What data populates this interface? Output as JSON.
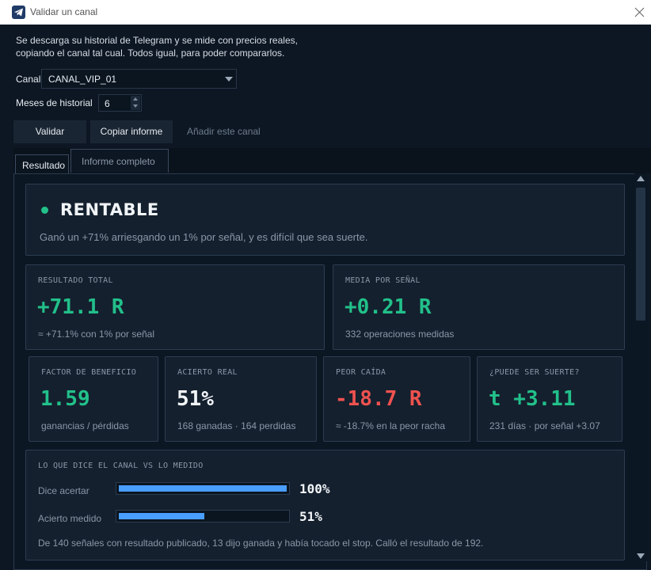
{
  "window": {
    "title": "Validar un canal"
  },
  "intro": {
    "line1": "Se descarga su historial de Telegram y se mide con precios reales,",
    "line2": "copiando el canal tal cual. Todos igual, para poder compararlos."
  },
  "form": {
    "channel_label": "Canal",
    "channel_value": "CANAL_VIP_01",
    "months_label": "Meses de historial",
    "months_value": "6"
  },
  "actions": {
    "validate": "Validar",
    "copy_report": "Copiar informe",
    "add_channel": "Añadir este canal"
  },
  "tabs": {
    "result": "Resultado",
    "full_report": "Informe completo"
  },
  "verdict": {
    "title": "RENTABLE",
    "subtitle": "Ganó un +71% arriesgando un 1% por señal, y es difícil que sea suerte.",
    "color": "#22c08a"
  },
  "metrics": {
    "total": {
      "label": "RESULTADO TOTAL",
      "value": "+71.1 R",
      "note": "≈ +71.1% con 1% por señal"
    },
    "avg": {
      "label": "MEDIA POR SEÑAL",
      "value": "+0.21 R",
      "note": "332 operaciones medidas"
    },
    "pf": {
      "label": "FACTOR DE BENEFICIO",
      "value": "1.59",
      "note": "ganancias / pérdidas"
    },
    "winrate": {
      "label": "ACIERTO REAL",
      "value": "51%",
      "note": "168 ganadas · 164 perdidas"
    },
    "drawdown": {
      "label": "PEOR CAÍDA",
      "value": "-18.7 R",
      "note": "≈ -18.7% en la peor racha"
    },
    "luck": {
      "label": "¿PUEDE SER SUERTE?",
      "value": "t +3.11",
      "note": "231 días · por señal +3.07"
    }
  },
  "comparison": {
    "title": "LO QUE DICE EL CANAL VS LO MEDIDO",
    "claimed_label": "Dice acertar",
    "claimed_pct": "100%",
    "claimed_fraction": 1.0,
    "measured_label": "Acierto medido",
    "measured_pct": "51%",
    "measured_fraction": 0.51,
    "note": "De 140 señales con resultado publicado, 13 dijo ganada y había tocado el stop. Calló el resultado de 192.",
    "bar_color": "#4a9eff"
  }
}
